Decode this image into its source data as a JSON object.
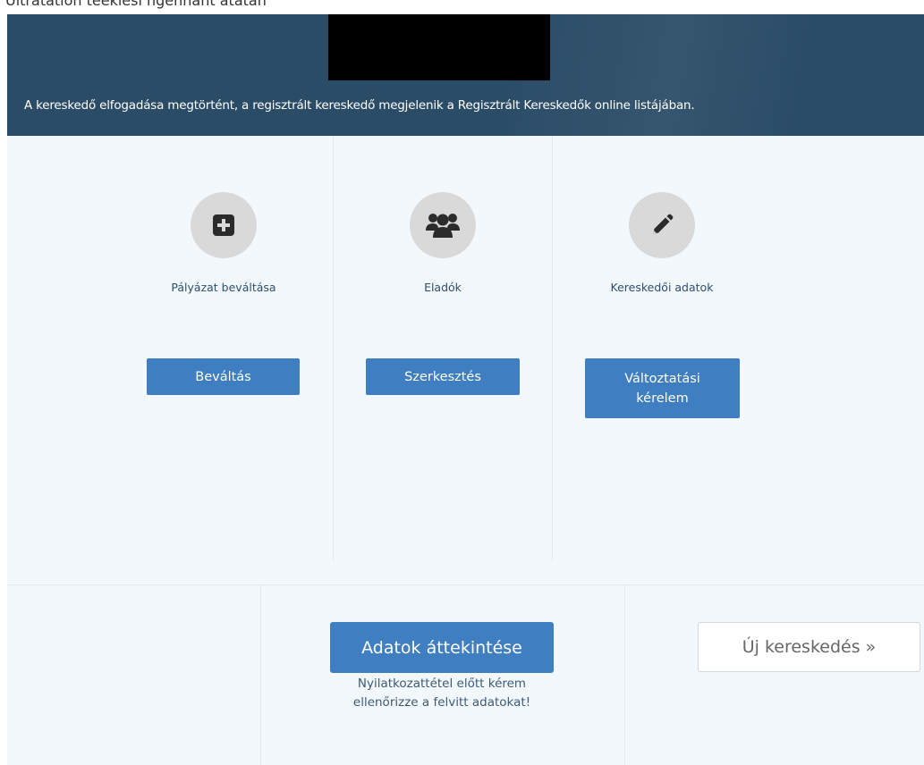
{
  "header": {
    "redacted_block": "",
    "message": "A kereskedő elfogadása megtörtént, a regisztrált kereskedő megjelenik a Regisztrált Kereskedők online listájában.",
    "banner_color": "#2b4c67"
  },
  "top_strip": {
    "partial_text": "Ultratation teekiesi ngennant atatan"
  },
  "actions": [
    {
      "icon": "plus-square-icon",
      "label": "Pályázat beváltása",
      "button": "Beváltás"
    },
    {
      "icon": "users-icon",
      "label": "Eladók",
      "button": "Szerkesztés"
    },
    {
      "icon": "pencil-icon",
      "label": "Kereskedői adatok",
      "button_line1": "Változtatási",
      "button_line2": "kérelem"
    }
  ],
  "footer": {
    "review_button": "Adatok áttekintése",
    "review_note_line1": "Nyilatkozattétel előtt kérem",
    "review_note_line2": "ellenőrizze a felvitt adatokat!",
    "new_trade_button": "Új kereskedés »"
  },
  "colors": {
    "accent": "#3f7ec1",
    "panel": "#f3f8fd",
    "label": "#2c4f6e"
  }
}
